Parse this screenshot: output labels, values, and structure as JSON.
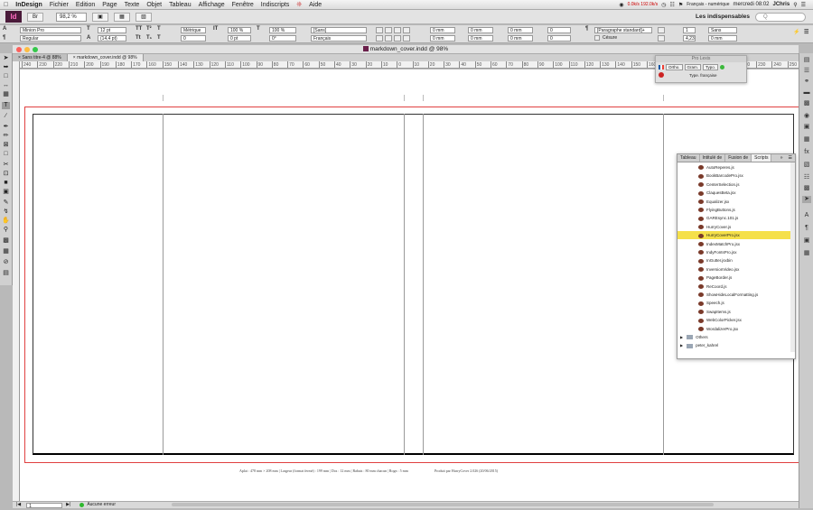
{
  "menubar": {
    "apple": "",
    "app": "InDesign",
    "items": [
      "Fichier",
      "Edition",
      "Page",
      "Texte",
      "Objet",
      "Tableau",
      "Affichage",
      "Fenêtre",
      "Indiscripts",
      "Aide"
    ],
    "network": "0.0k/s 192.0k/s",
    "input_source": "Français - numérique",
    "clock": "mercredi 08:02",
    "user": "JChris"
  },
  "appbar": {
    "logo": "Id",
    "zoom": "98,2 %",
    "workspace": "Les indispensables",
    "search_placeholder": "Q"
  },
  "control": {
    "font": "Minion Pro",
    "style": "Regular",
    "size": "12 pt",
    "leading": "(14,4 pt)",
    "kerning": "Métrique",
    "tracking": "0",
    "vscale": "100 %",
    "hscale": "100 %",
    "baseline": "0 pt",
    "skew": "0°",
    "char_style": "[Sans]",
    "language": "Français",
    "indent_left": "0 mm",
    "indent_first": "0 mm",
    "indent_right": "0 mm",
    "indent_last": "0 mm",
    "space_before": "0 mm",
    "space_after": "0 mm",
    "dropcap_lines": "0",
    "dropcap_chars": "0",
    "para_style": "[Paragraphe standard]+",
    "hyphenation": "Césure",
    "columns": "1",
    "col_gutter": "4,233",
    "col_span": "Sans",
    "span_gutter": "0 mm"
  },
  "document": {
    "title": "markdown_cover.indd @ 98%",
    "tabs": [
      "Sans titre-4 @ 88%",
      "markdown_cover.indd @ 98%"
    ],
    "ruler_ticks": [
      "240",
      "230",
      "220",
      "210",
      "200",
      "190",
      "180",
      "170",
      "160",
      "150",
      "140",
      "130",
      "120",
      "110",
      "100",
      "90",
      "80",
      "70",
      "60",
      "50",
      "40",
      "30",
      "20",
      "10",
      "0",
      "10",
      "20",
      "30",
      "40",
      "50",
      "60",
      "70",
      "80",
      "90",
      "100",
      "110",
      "120",
      "130",
      "140",
      "150",
      "160",
      "170",
      "180",
      "190",
      "200",
      "210",
      "220",
      "230",
      "240",
      "250"
    ],
    "slug_left": "Aplat : 478 mm × 208 mm  |  Largeur (format fermé) : 199 mm  |  Dos : 12 mm  |  Rabats : 80 mm chacun  |  Rogn : 5 mm",
    "slug_right": "Produit par HurryCover 2.026 (20/06/2015)"
  },
  "prolexis": {
    "title": "Pro Lexis",
    "btn_ortho": "Ortho.",
    "btn_gram": "Gram.",
    "btn_typo": "Typo.",
    "type_label": "Type. française"
  },
  "scripts_panel": {
    "tabs": [
      "Tableau",
      "Intitulé de",
      "Fusion de",
      "Scripts"
    ],
    "items": [
      "AutoReperes.js",
      "BookBarcodePro.jsx",
      "CenterSelection.js",
      "ClaquesBeta.jsx",
      "Equalizer.jsx",
      "FlyingButtons.js",
      "GAREsync.101.js",
      "HurryCover.js",
      "HurryCoverPro.jsx",
      "IndexMatchPro.jsx",
      "IndyFontsPro.jsx",
      "InGutter.jsxbin",
      "InversionVideo.jsx",
      "PageBorder.js",
      "ReCoord.js",
      "ShowHideLocalFormatting.js",
      "Speech.js",
      "SwapItems.js",
      "WebColorPicker.jsx",
      "WordalizerPro.jsx"
    ],
    "selected": "HurryCoverPro.jsx",
    "folders": [
      "Others",
      "peter_kahrel"
    ]
  },
  "statusbar": {
    "page": "1",
    "preflight": "Aucune erreur"
  }
}
